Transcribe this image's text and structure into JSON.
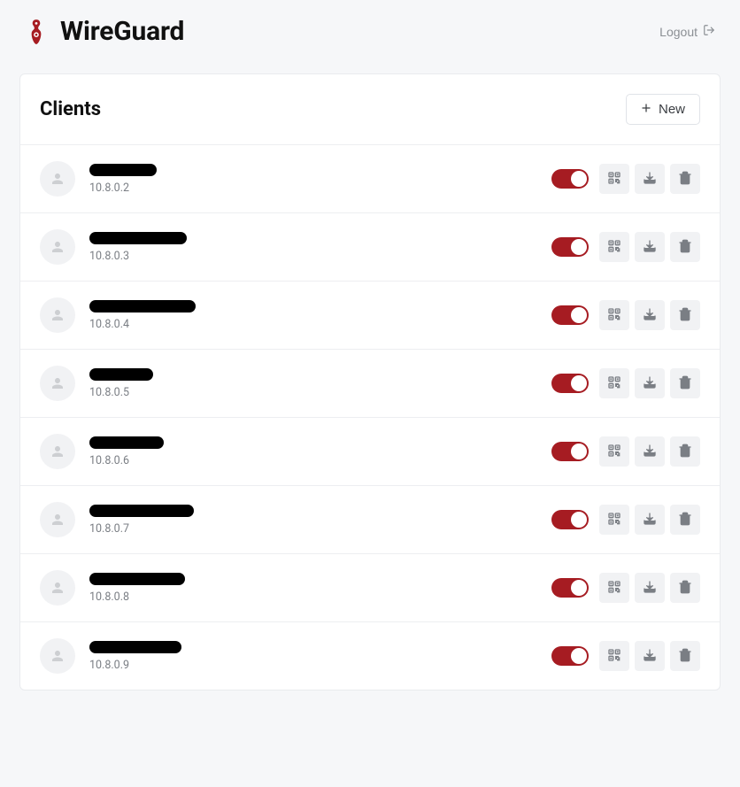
{
  "header": {
    "title": "WireGuard",
    "logout_label": "Logout"
  },
  "panel": {
    "title": "Clients",
    "new_label": "New"
  },
  "colors": {
    "accent": "#a61c22"
  },
  "clients": [
    {
      "name_redacted": true,
      "redact_width": 76,
      "ip": "10.8.0.2",
      "enabled": true
    },
    {
      "name_redacted": true,
      "redact_width": 110,
      "ip": "10.8.0.3",
      "enabled": true
    },
    {
      "name_redacted": true,
      "redact_width": 120,
      "ip": "10.8.0.4",
      "enabled": true
    },
    {
      "name_redacted": true,
      "redact_width": 72,
      "ip": "10.8.0.5",
      "enabled": true
    },
    {
      "name_redacted": true,
      "redact_width": 84,
      "ip": "10.8.0.6",
      "enabled": true
    },
    {
      "name_redacted": true,
      "redact_width": 118,
      "ip": "10.8.0.7",
      "enabled": true
    },
    {
      "name_redacted": true,
      "redact_width": 108,
      "ip": "10.8.0.8",
      "enabled": true
    },
    {
      "name_redacted": true,
      "redact_width": 104,
      "ip": "10.8.0.9",
      "enabled": true
    }
  ]
}
